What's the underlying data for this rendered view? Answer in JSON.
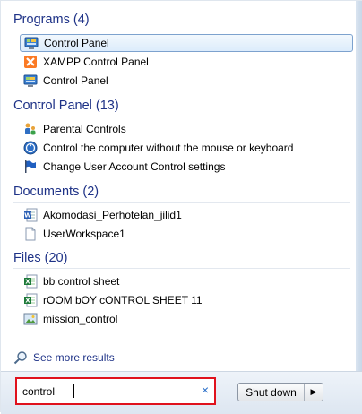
{
  "groups": [
    {
      "header": "Programs (4)",
      "items": [
        {
          "label": "Control Panel",
          "icon": "control-panel-icon",
          "selected": true
        },
        {
          "label": "XAMPP Control Panel",
          "icon": "xampp-icon",
          "selected": false
        },
        {
          "label": "Control Panel",
          "icon": "control-panel-icon",
          "selected": false
        }
      ]
    },
    {
      "header": "Control Panel (13)",
      "items": [
        {
          "label": "Parental Controls",
          "icon": "parental-controls-icon"
        },
        {
          "label": "Control the computer without the mouse or keyboard",
          "icon": "ease-of-access-icon"
        },
        {
          "label": "Change User Account Control settings",
          "icon": "uac-flag-icon"
        }
      ]
    },
    {
      "header": "Documents (2)",
      "items": [
        {
          "label": "Akomodasi_Perhotelan_jilid1",
          "icon": "word-document-icon"
        },
        {
          "label": "UserWorkspace1",
          "icon": "blank-document-icon"
        }
      ]
    },
    {
      "header": "Files (20)",
      "items": [
        {
          "label": "bb control sheet",
          "icon": "excel-document-icon"
        },
        {
          "label": "rOOM bOY cONTROL SHEET 11",
          "icon": "excel-document-icon"
        },
        {
          "label": "mission_control",
          "icon": "image-file-icon"
        }
      ]
    }
  ],
  "see_more": {
    "label": "See more results",
    "icon": "magnifier-icon"
  },
  "search": {
    "value": "control",
    "clear_symbol": "×",
    "clear_icon": "clear-x-icon"
  },
  "shutdown": {
    "label": "Shut down",
    "arrow": "▶",
    "arrow_icon": "arrow-right-icon"
  },
  "colors": {
    "header": "#1e3287",
    "search_highlight": "#e0121d",
    "selection_border": "#7da2ce"
  }
}
